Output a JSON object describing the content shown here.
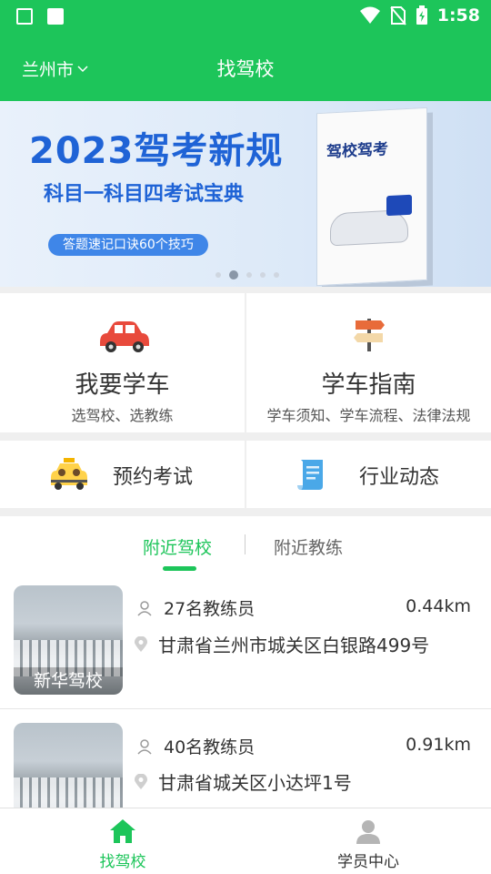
{
  "status": {
    "time": "1:58"
  },
  "header": {
    "city": "兰州市",
    "title": "找驾校"
  },
  "banner": {
    "title": "2023驾考新规",
    "subtitle": "科目一科目四考试宝典",
    "tag": "答题速记口诀60个技巧",
    "book_title": "驾校驾考"
  },
  "cards": {
    "learn": {
      "title": "我要学车",
      "sub": "选驾校、选教练"
    },
    "guide": {
      "title": "学车指南",
      "sub": "学车须知、学车流程、法律法规"
    },
    "exam": {
      "title": "预约考试"
    },
    "news": {
      "title": "行业动态"
    }
  },
  "tabs": {
    "active": "附近驾校",
    "inactive": "附近教练"
  },
  "schools": [
    {
      "name": "新华驾校",
      "coaches": "27名教练员",
      "distance": "0.44km",
      "address": "甘肃省兰州市城关区白银路499号"
    },
    {
      "name": "",
      "coaches": "40名教练员",
      "distance": "0.91km",
      "address": "甘肃省城关区小达坪1号"
    }
  ],
  "bottom_nav": {
    "find": "找驾校",
    "center": "学员中心"
  },
  "colors": {
    "accent": "#1dc55a",
    "banner_blue": "#1f63d6"
  }
}
